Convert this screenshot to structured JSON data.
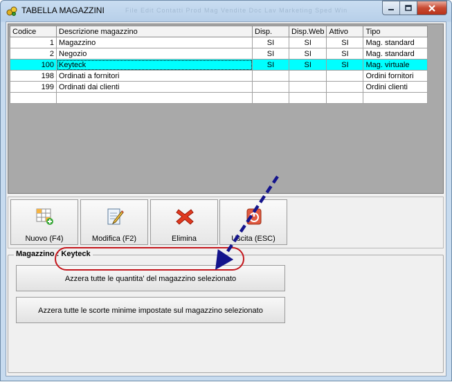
{
  "window": {
    "title": "TABELLA MAGAZZINI",
    "background_menu_ghost": "File   Edit   Contatti   Prod   Mag   Vendite   Doc   Lav   Marketing   Sped   Win"
  },
  "grid": {
    "columns": [
      "Codice",
      "Descrizione magazzino",
      "Disp.",
      "Disp.Web",
      "Attivo",
      "Tipo"
    ],
    "rows": [
      {
        "codice": "1",
        "descrizione": "Magazzino",
        "disp": "SI",
        "disp_web": "SI",
        "attivo": "SI",
        "tipo": "Mag. standard"
      },
      {
        "codice": "2",
        "descrizione": "Negozio",
        "disp": "SI",
        "disp_web": "SI",
        "attivo": "SI",
        "tipo": "Mag. standard"
      },
      {
        "codice": "100",
        "descrizione": "Keyteck",
        "disp": "SI",
        "disp_web": "SI",
        "attivo": "SI",
        "tipo": "Mag. virtuale"
      },
      {
        "codice": "198",
        "descrizione": "Ordinati a fornitori",
        "disp": "",
        "disp_web": "",
        "attivo": "",
        "tipo": "Ordini fornitori"
      },
      {
        "codice": "199",
        "descrizione": "Ordinati dai clienti",
        "disp": "",
        "disp_web": "",
        "attivo": "",
        "tipo": "Ordini clienti"
      },
      {
        "codice": "",
        "descrizione": "",
        "disp": "",
        "disp_web": "",
        "attivo": "",
        "tipo": ""
      }
    ],
    "selected_row": 2,
    "selection_color": "#00ffff"
  },
  "toolbar": {
    "nuovo": "Nuovo (F4)",
    "modifica": "Modifica (F2)",
    "elimina": "Elimina",
    "uscita": "Uscita (ESC)"
  },
  "group": {
    "title": "Magazzino : Keyteck",
    "azzera_quantita": "Azzera tutte le quantita' del magazzino selezionato",
    "azzera_scorte": "Azzera tutte le scorte minime impostate sul magazzino selezionato"
  },
  "annotation": {
    "arrow_color": "#14148c",
    "oval_color": "#c4161c"
  },
  "icons": [
    "app-icon",
    "minimize-icon",
    "maximize-icon",
    "close-icon",
    "new-grid-icon",
    "edit-document-icon",
    "delete-x-icon",
    "exit-power-icon"
  ]
}
